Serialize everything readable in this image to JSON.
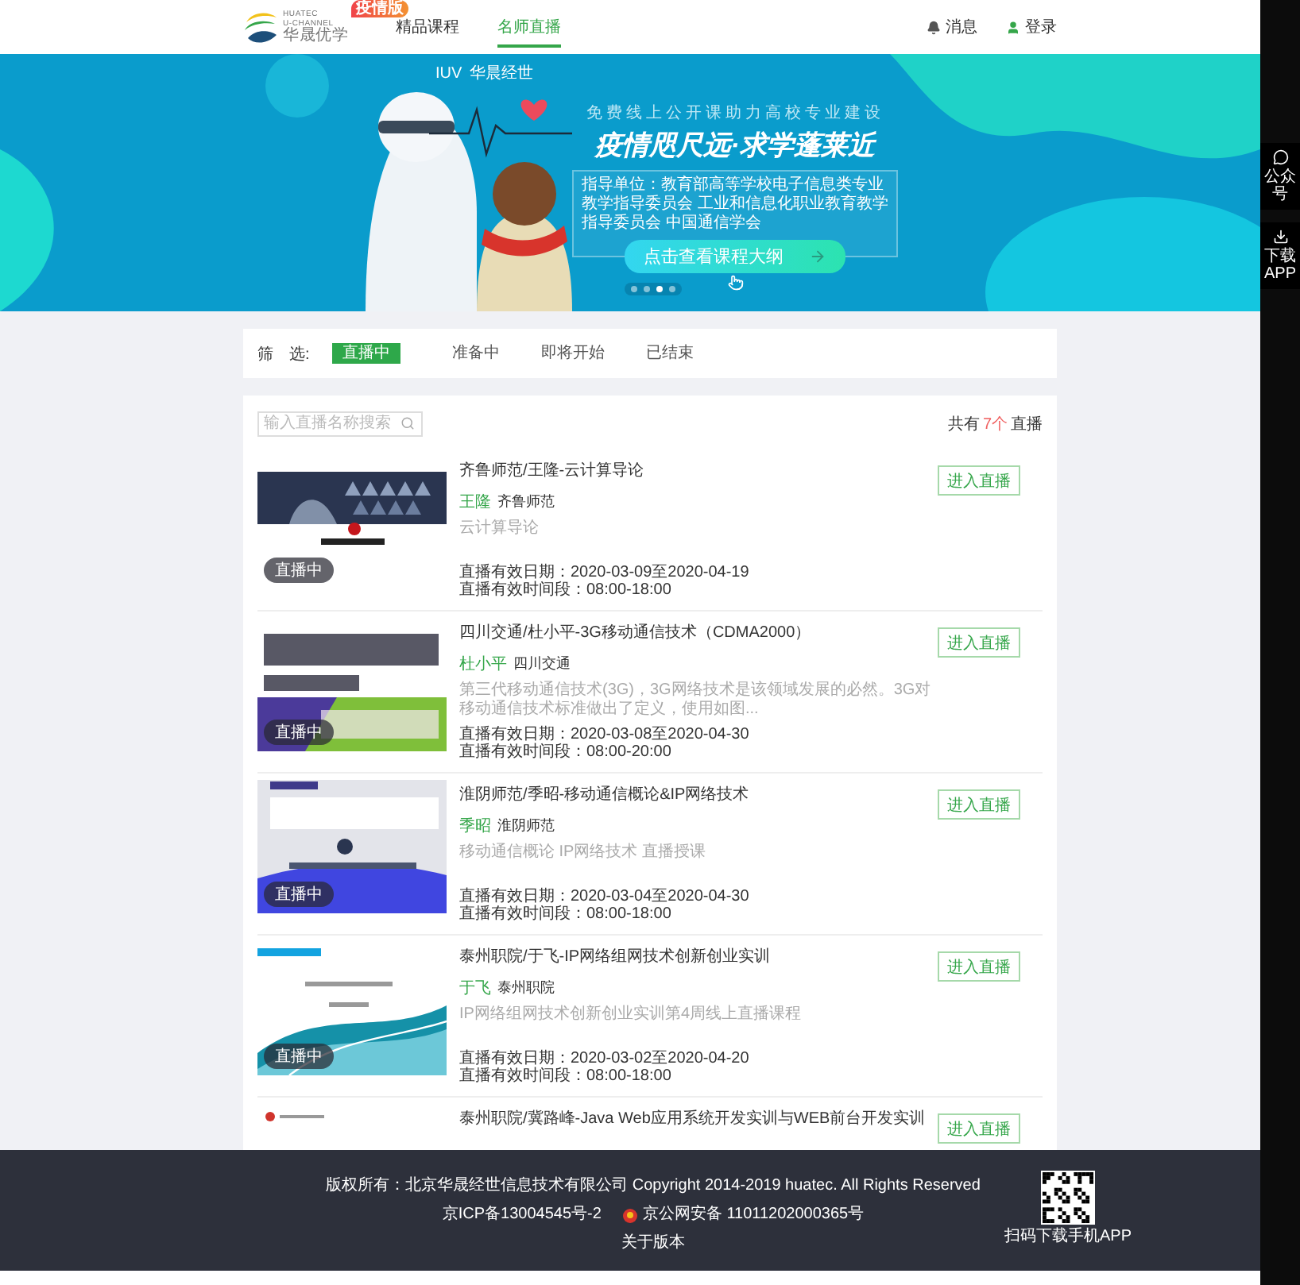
{
  "header": {
    "logo": {
      "lines": [
        "HUATEC",
        "U-CHANNEL",
        "华晟优学"
      ],
      "badge": "疫情版"
    },
    "nav": [
      {
        "label": "精品课程",
        "selected": false
      },
      {
        "label": "名师直播",
        "selected": true
      }
    ],
    "actions": [
      {
        "kind": "bell",
        "label": "消息"
      },
      {
        "kind": "user",
        "label": "登录"
      }
    ]
  },
  "banner": {
    "mark": "IUV",
    "brand": "华晨经世",
    "subtitle": "免费线上公开课助力高校专业建设",
    "headline": "疫情咫尺远·求学蓬莱近",
    "guide": "指导单位：教育部高等学校电子信息类专业教学指导委员会 工业和信息化职业教育教学指导委员会 中国通信学会",
    "cta": "点击查看课程大纲",
    "dots": [
      {
        "selected": false
      },
      {
        "selected": false
      },
      {
        "selected": true
      },
      {
        "selected": false
      }
    ]
  },
  "filter": {
    "label": "筛　选:",
    "options": [
      {
        "label": "直播中",
        "selected": true
      },
      {
        "label": "准备中",
        "selected": false
      },
      {
        "label": "即将开始",
        "selected": false
      },
      {
        "label": "已结束",
        "selected": false
      }
    ]
  },
  "search": {
    "placeholder": "输入直播名称搜索"
  },
  "count": {
    "prefix": "共有",
    "value": "7个",
    "suffix": "直播"
  },
  "courses": [
    {
      "title": "齐鲁师范/王隆-云计算导论",
      "teacher": "王隆",
      "school": "齐鲁师范",
      "description": "云计算导论",
      "date": "直播有效日期：2020-03-09至2020-04-19",
      "time": "直播有效时间段：08:00-18:00",
      "badge": "直播中",
      "button": "进入直播"
    },
    {
      "title": "四川交通/杜小平-3G移动通信技术（CDMA2000）",
      "teacher": "杜小平",
      "school": "四川交通",
      "description": "第三代移动通信技术(3G)，3G网络技术是该领域发展的必然。3G对移动通信技术标准做出了定义，使用如图...",
      "date": "直播有效日期：2020-03-08至2020-04-30",
      "time": "直播有效时间段：08:00-20:00",
      "badge": "直播中",
      "button": "进入直播"
    },
    {
      "title": "淮阴师范/季昭-移动通信概论&IP网络技术",
      "teacher": "季昭",
      "school": "淮阴师范",
      "description": "移动通信概论 IP网络技术 直播授课",
      "date": "直播有效日期：2020-03-04至2020-04-30",
      "time": "直播有效时间段：08:00-18:00",
      "badge": "直播中",
      "button": "进入直播"
    },
    {
      "title": "泰州职院/于飞-IP网络组网技术创新创业实训",
      "teacher": "于飞",
      "school": "泰州职院",
      "description": "IP网络组网技术创新创业实训第4周线上直播课程",
      "date": "直播有效日期：2020-03-02至2020-04-20",
      "time": "直播有效时间段：08:00-18:00",
      "badge": "直播中",
      "button": "进入直播"
    },
    {
      "title": "泰州职院/冀路峰-Java Web应用系统开发实训与WEB前台开发实训",
      "button": "进入直播"
    }
  ],
  "footer": {
    "copyright": "版权所有：北京华晟经世信息技术有限公司 Copyright 2014-2019 huatec. All Rights Reserved",
    "icp": "京ICP备13004545号-2",
    "police": "京公网安备 11011202000365号",
    "about": "关于版本",
    "qr_label": "扫码下载手机APP"
  },
  "sidebar": [
    {
      "kind": "chat",
      "label": "公众号"
    },
    {
      "kind": "download",
      "label": "下载APP"
    }
  ]
}
